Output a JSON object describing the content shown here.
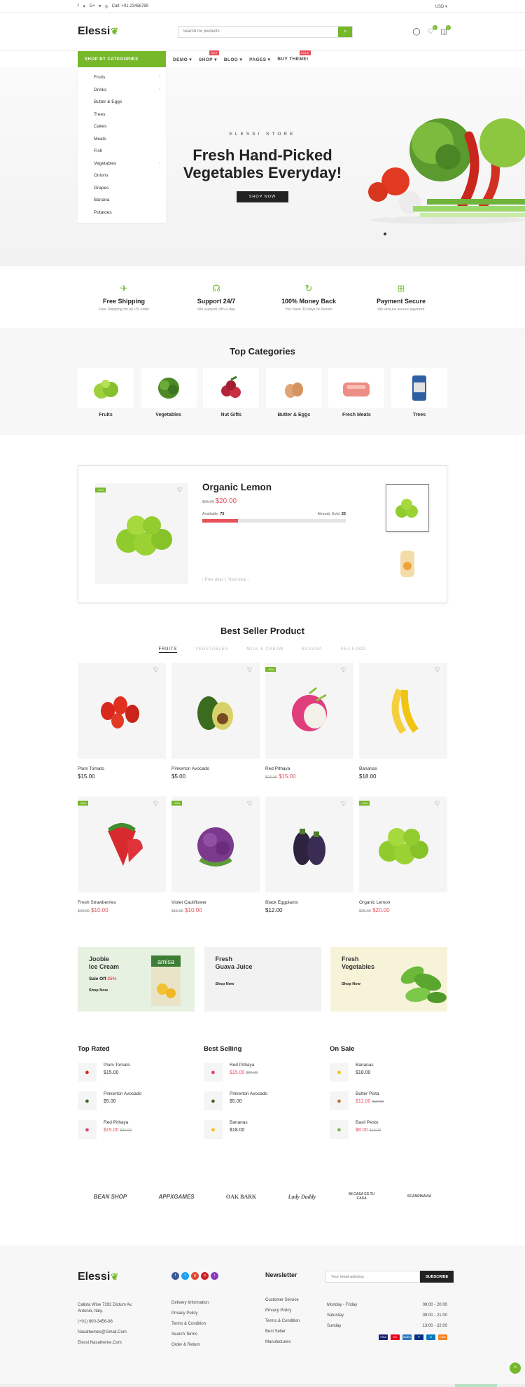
{
  "topbar": {
    "call": "Call:  +01 23456789",
    "currency": "USD"
  },
  "header": {
    "logo": "Elessi",
    "search_placeholder": "Search for products",
    "wishlist_count": "0",
    "cart_count": "0"
  },
  "nav": {
    "categories_label": "SHOP BY CATEGORIES",
    "menu": [
      {
        "label": "DEMO",
        "badge": ""
      },
      {
        "label": "SHOP",
        "badge": "HOT"
      },
      {
        "label": "BLOG",
        "badge": ""
      },
      {
        "label": "PAGES",
        "badge": ""
      },
      {
        "label": "BUY THEME!",
        "badge": "SALE"
      }
    ]
  },
  "categories": [
    "Fruits",
    "Drinks",
    "Butter & Eggs",
    "Trees",
    "Cakes",
    "Meats",
    "Fish",
    "Vegetables",
    "Onions",
    "Grapes",
    "Banana",
    "Potatoes"
  ],
  "hero": {
    "eyebrow": "ELESSI STORE",
    "title_line1": "Fresh Hand-Picked",
    "title_line2": "Vegetables Everyday!",
    "cta": "SHOP NOW"
  },
  "features": [
    {
      "icon": "plane-icon",
      "title": "Free Shipping",
      "text": "Free Shipping for all US order"
    },
    {
      "icon": "headset-icon",
      "title": "Support 24/7",
      "text": "We support 24h a day"
    },
    {
      "icon": "refresh-icon",
      "title": "100% Money Back",
      "text": "You have 30 days to Return"
    },
    {
      "icon": "gift-icon",
      "title": "Payment Secure",
      "text": "We ensure secure payment"
    }
  ],
  "top_categories": {
    "title": "Top Categories",
    "items": [
      "Fruits",
      "Vegetables",
      "Nut Gifts",
      "Butter & Eggs",
      "Fresh Meats",
      "Trees"
    ]
  },
  "deal": {
    "badge": "-20%",
    "name": "Organic Lemon",
    "old_price": "$25.00",
    "price": "$20.00",
    "available_label": "Available:",
    "available": "75",
    "sold_label": "Already Sold:",
    "sold": "25",
    "sold_fraction": 0.25,
    "prev": "Prev deal",
    "next": "Next deal"
  },
  "best": {
    "title": "Best Seller Product",
    "tabs": [
      "FRUITS",
      "VEGETABLES",
      "MILK & CREAM",
      "BANANA",
      "SEA FOOD"
    ],
    "products": [
      {
        "name": "Plum Tomato",
        "old": "",
        "price": "$15.00",
        "badge": ""
      },
      {
        "name": "Pinkerton Avocado",
        "old": "",
        "price": "$5.00",
        "badge": ""
      },
      {
        "name": "Red Pithaya",
        "old": "$20.00",
        "price": "$15.00",
        "badge": "-25%"
      },
      {
        "name": "Bananas",
        "old": "",
        "price": "$18.00",
        "badge": ""
      },
      {
        "name": "Fresh Strawberries",
        "old": "$20.00",
        "price": "$10.00",
        "badge": "-50%"
      },
      {
        "name": "Violet Cauliflower",
        "old": "$15.00",
        "price": "$10.00",
        "badge": "-33%"
      },
      {
        "name": "Black Eggplants",
        "old": "",
        "price": "$12.00",
        "badge": ""
      },
      {
        "name": "Organic Lemon",
        "old": "$25.00",
        "price": "$20.00",
        "badge": "-20%"
      }
    ]
  },
  "banners": [
    {
      "line1": "Joobie",
      "line2": "Ice Cream",
      "sale": "Sale Off",
      "pct": "25%",
      "cta": "Shop Now",
      "pack": "amisa"
    },
    {
      "line1": "Fresh",
      "line2": "Guava Juice",
      "sale": "",
      "pct": "",
      "cta": "Shop Now"
    },
    {
      "line1": "Fresh",
      "line2": "Vegetables",
      "sale": "",
      "pct": "",
      "cta": "Shop Now"
    }
  ],
  "lists": [
    {
      "title": "Top Rated",
      "items": [
        {
          "name": "Plum Tomato",
          "old": "",
          "price": "$15.00"
        },
        {
          "name": "Pinkerton Avocado",
          "old": "",
          "price": "$5.00"
        },
        {
          "name": "Red Pithaya",
          "old": "$20.00",
          "price": "$15.00"
        }
      ]
    },
    {
      "title": "Best Selling",
      "items": [
        {
          "name": "Red Pithaya",
          "old": "$20.00",
          "price": "$15.00"
        },
        {
          "name": "Pinkerton Avocado",
          "old": "",
          "price": "$5.00"
        },
        {
          "name": "Bananas",
          "old": "",
          "price": "$18.00"
        }
      ]
    },
    {
      "title": "On Sale",
      "items": [
        {
          "name": "Bananas",
          "old": "",
          "price": "$18.00"
        },
        {
          "name": "Butter Pista",
          "old": "$18.00",
          "price": "$12.00"
        },
        {
          "name": "Basil Pesto",
          "old": "$10.00",
          "price": "$8.00"
        }
      ]
    }
  ],
  "brands": [
    "BEAN SHOP",
    "APPXGAMES",
    "OAK BARK",
    "Lady Daddy",
    "MI CASA ES TU CASA",
    "SCANDINAVIA"
  ],
  "footer": {
    "logo": "Elessi",
    "address1": "Calista Wise 7292 Dictum Av.",
    "address2": "Antonio, Italy.",
    "phone": "(+01) 800-3456-88",
    "email": "Nasathemes@Gmail.Com",
    "site": "Elessi.Nasatheme.Com",
    "links1": [
      "Delivery Information",
      "Privacy Policy",
      "Terms & Condition",
      "Search Terms",
      "Order & Return"
    ],
    "links2": [
      "Customer Service",
      "Privacy Policy",
      "Terms & Condition",
      "Best Seller",
      "Manufactures"
    ],
    "newsletter_title": "Newsletter",
    "newsletter_placeholder": "Your email address",
    "subscribe": "SUBSCRIBE",
    "hours": [
      {
        "day": "Monday - Friday",
        "time": "08:00 - 20:00"
      },
      {
        "day": "Saturday",
        "time": "09:00 - 21:00"
      },
      {
        "day": "Sunday",
        "time": "13:00 - 22:00"
      }
    ],
    "payments": [
      "VISA",
      "MC",
      "AMEX",
      "P",
      "D",
      "DISC"
    ]
  }
}
